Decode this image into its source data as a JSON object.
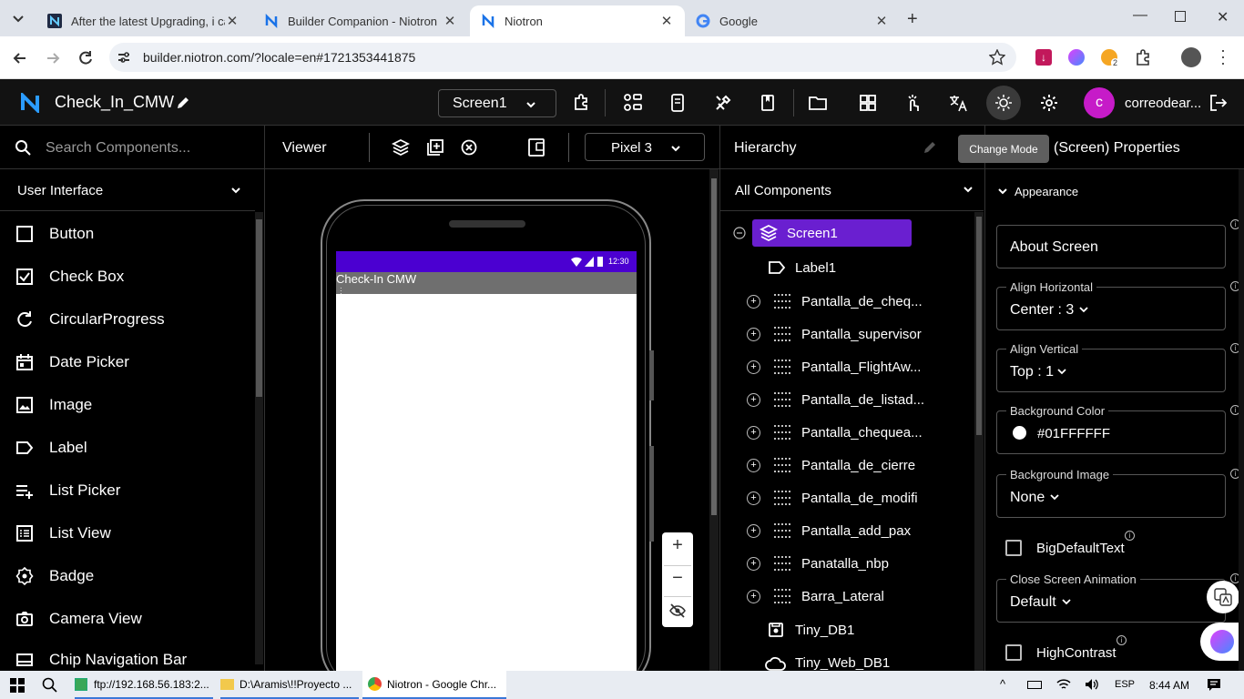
{
  "browser": {
    "tabs": [
      {
        "title": "After the latest Upgrading, i ca"
      },
      {
        "title": "Builder Companion - Niotron"
      },
      {
        "title": "Niotron"
      },
      {
        "title": "Google"
      }
    ],
    "url": "builder.niotron.com/?locale=en#1721353441875",
    "ext_badge": "2"
  },
  "app": {
    "project_name": "Check_In_CMW",
    "screen_select": "Screen1",
    "tooltip": "Change Mode",
    "user_initial": "c",
    "user_name": "correodear..."
  },
  "palette": {
    "search_placeholder": "Search Components...",
    "category": "User Interface",
    "items": [
      "Button",
      "Check Box",
      "CircularProgress",
      "Date Picker",
      "Image",
      "Label",
      "List Picker",
      "List View",
      "Badge",
      "Camera View",
      "Chip Navigation Bar"
    ]
  },
  "viewer": {
    "title": "Viewer",
    "device": "Pixel 3",
    "status_time": "12:30",
    "app_title": "Check-In CMW"
  },
  "hierarchy": {
    "title": "Hierarchy",
    "filter": "All Components",
    "root": "Screen1",
    "nodes": [
      "Label1",
      "Pantalla_de_cheq...",
      "Pantalla_supervisor",
      "Pantalla_FlightAw...",
      "Pantalla_de_listad...",
      "Pantalla_chequea...",
      "Pantalla_de_cierre",
      "Pantalla_de_modifi",
      "Pantalla_add_pax",
      "Panatalla_nbp",
      "Barra_Lateral",
      "Tiny_DB1",
      "Tiny_Web_DB1"
    ]
  },
  "properties": {
    "title": "(Screen) Properties",
    "section": "Appearance",
    "about_screen": "About Screen",
    "align_h_label": "Align Horizontal",
    "align_h_value": "Center : 3",
    "align_v_label": "Align Vertical",
    "align_v_value": "Top : 1",
    "bg_color_label": "Background Color",
    "bg_color_value": "#01FFFFFF",
    "bg_image_label": "Background Image",
    "bg_image_value": "None",
    "big_default_text": "BigDefaultText",
    "close_anim_label": "Close Screen Animation",
    "close_anim_value": "Default",
    "high_contrast": "HighContrast"
  },
  "taskbar": {
    "items": [
      "ftp://192.168.56.183:2...",
      "D:\\Aramis\\!!Proyecto ...",
      "Niotron - Google Chr..."
    ],
    "lang": "ESP",
    "time": "8:44 AM"
  },
  "colors": {
    "accent": "#5b13c7",
    "avatar": "#c61bc8",
    "screen_row": "#6a1fd0"
  }
}
